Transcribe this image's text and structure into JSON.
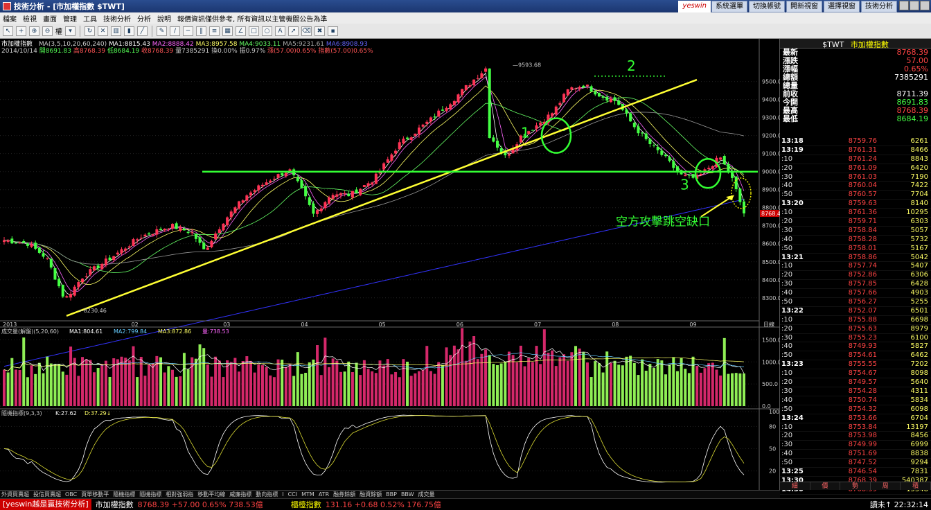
{
  "window": {
    "title": "技術分析 - [市加權指數 $TWT]"
  },
  "topbar": {
    "logo": "yeswin",
    "buttons": [
      "系統選單",
      "切換帳號",
      "開新視窗",
      "選擇視窗",
      "技術分析"
    ]
  },
  "menu": {
    "items": [
      "檔案",
      "檢視",
      "畫面",
      "管理",
      "工具",
      "技術分析",
      "分析",
      "說明",
      "報價資訊僅供參考, 所有資訊以主管機關公告為準"
    ]
  },
  "toolbar": {
    "zoom_label": "權"
  },
  "chart": {
    "symbol": "市加權指數",
    "ma_params": "MA(3,5,10,20,60,240)",
    "ma": [
      "MA1:8815.43",
      "MA2:8888.42",
      "MA3:8957.58",
      "MA4:9033.11",
      "MA5:9231.61",
      "MA6:8908.93"
    ],
    "bar_date": "2014/10/14",
    "ohlc": [
      "開8691.83",
      "高8768.39",
      "低8684.19",
      "收8768.39"
    ],
    "volume": "量7385291",
    "turnover": "換0.00%",
    "amplitude": "振0.97%",
    "change": "漲(57.00)0.65%",
    "index_change": "指數(57.00)0.65%",
    "y_ticks": [
      "9500.00",
      "9400.00",
      "9300.00",
      "9200.00",
      "9100.00",
      "9000.00",
      "8900.00",
      "8800.00",
      "8700.00",
      "8600.00",
      "8500.00",
      "8400.00",
      "8300.00"
    ],
    "x_labels": [
      "2013",
      "02",
      "03",
      "04",
      "05",
      "06",
      "07",
      "08",
      "09",
      "10"
    ],
    "period_label": "日線",
    "high_label": "9593.68",
    "low_label": "8230.46",
    "last_tag": "8768.4",
    "annotations": {
      "n1": "1",
      "n2": "2",
      "n3": "3",
      "gap_text": "空方攻擊跳空缺口"
    }
  },
  "volume_panel": {
    "title": "成交量(解盤)(5,20,60)",
    "ma": [
      "MA1:804.61",
      "MA2:799.84",
      "MA3:872.86",
      "量:738.53"
    ],
    "y_ticks": [
      "1500.0",
      "1000.0",
      "500.0",
      "0.0"
    ]
  },
  "kd_panel": {
    "title": "隨機指標(9,3,3)",
    "k": "K:27.62",
    "d": "D:37.29",
    "y_ticks": [
      "100",
      "80",
      "50",
      "20"
    ]
  },
  "indicator_tabs": [
    "外資買賣超",
    "投信買賣超",
    "OBC",
    "買單移動平",
    "隨機指標",
    "隨機指標",
    "相對強弱指",
    "移動平均線",
    "威廉指標",
    "動向指標",
    "I",
    "CCI",
    "MTM",
    "ATR",
    "融券餘額",
    "融資餘額",
    "BBP",
    "BBW",
    "成交量"
  ],
  "quote_panel": {
    "header": "$TWT",
    "name": "市加權指數",
    "rows": [
      {
        "label": "最新",
        "value": "8768.39",
        "color": "#ff4444"
      },
      {
        "label": "漲跌",
        "value": "57.00",
        "color": "#ff4444"
      },
      {
        "label": "漲幅",
        "value": "0.65%",
        "color": "#ff4444"
      },
      {
        "label": "總額",
        "value": "7385291",
        "color": "#ffffff"
      },
      {
        "label": "總量",
        "value": "",
        "color": "#ffffff"
      },
      {
        "label": "前收",
        "value": "8711.39",
        "color": "#ffffff"
      },
      {
        "label": "今開",
        "value": "8691.83",
        "color": "#44ff44"
      },
      {
        "label": "最高",
        "value": "8768.39",
        "color": "#ff4444"
      },
      {
        "label": "最低",
        "value": "8684.19",
        "color": "#44ff44"
      }
    ],
    "ticks": [
      {
        "time": "13:18",
        "price": "8759.76",
        "vol": "6261"
      },
      {
        "time": "13:19",
        "price": "8761.31",
        "vol": "8466"
      },
      {
        "time": ":10",
        "price": "8761.24",
        "vol": "8843"
      },
      {
        "time": ":20",
        "price": "8761.09",
        "vol": "6420"
      },
      {
        "time": ":30",
        "price": "8761.03",
        "vol": "7190"
      },
      {
        "time": ":40",
        "price": "8760.04",
        "vol": "7422"
      },
      {
        "time": ":50",
        "price": "8760.57",
        "vol": "7704"
      },
      {
        "time": "13:20",
        "price": "8759.63",
        "vol": "8140"
      },
      {
        "time": ":10",
        "price": "8761.36",
        "vol": "10295"
      },
      {
        "time": ":20",
        "price": "8759.71",
        "vol": "6303"
      },
      {
        "time": ":30",
        "price": "8758.84",
        "vol": "5057"
      },
      {
        "time": ":40",
        "price": "8758.28",
        "vol": "5732"
      },
      {
        "time": ":50",
        "price": "8758.01",
        "vol": "5167"
      },
      {
        "time": "13:21",
        "price": "8758.86",
        "vol": "5042"
      },
      {
        "time": ":10",
        "price": "8757.74",
        "vol": "5407"
      },
      {
        "time": ":20",
        "price": "8752.86",
        "vol": "6306"
      },
      {
        "time": ":30",
        "price": "8757.85",
        "vol": "6428"
      },
      {
        "time": ":40",
        "price": "8757.66",
        "vol": "4903"
      },
      {
        "time": ":50",
        "price": "8756.27",
        "vol": "5255"
      },
      {
        "time": "13:22",
        "price": "8752.07",
        "vol": "6501"
      },
      {
        "time": ":10",
        "price": "8755.88",
        "vol": "6698"
      },
      {
        "time": ":20",
        "price": "8755.63",
        "vol": "8979"
      },
      {
        "time": ":30",
        "price": "8755.23",
        "vol": "6100"
      },
      {
        "time": ":40",
        "price": "8749.93",
        "vol": "5827"
      },
      {
        "time": ":50",
        "price": "8754.61",
        "vol": "6462"
      },
      {
        "time": "13:23",
        "price": "8755.55",
        "vol": "7202"
      },
      {
        "time": ":10",
        "price": "8754.67",
        "vol": "8098"
      },
      {
        "time": ":20",
        "price": "8749.57",
        "vol": "5640"
      },
      {
        "time": ":30",
        "price": "8754.28",
        "vol": "4311"
      },
      {
        "time": ":40",
        "price": "8750.74",
        "vol": "5834"
      },
      {
        "time": ":50",
        "price": "8754.32",
        "vol": "6098"
      },
      {
        "time": "13:24",
        "price": "8753.66",
        "vol": "6704"
      },
      {
        "time": ":10",
        "price": "8753.84",
        "vol": "13197"
      },
      {
        "time": ":20",
        "price": "8753.98",
        "vol": "8456"
      },
      {
        "time": ":30",
        "price": "8749.99",
        "vol": "6999"
      },
      {
        "time": ":40",
        "price": "8751.69",
        "vol": "8838"
      },
      {
        "time": ":50",
        "price": "8747.52",
        "vol": "9294"
      },
      {
        "time": "13:25",
        "price": "8746.54",
        "vol": "7831"
      },
      {
        "time": "13:30",
        "price": "8768.39",
        "vol": "540387"
      },
      {
        "time": "14:30",
        "price": "8768.39",
        "vol": "15548"
      }
    ],
    "tabs": [
      "細",
      "價",
      "勢",
      "周",
      "積"
    ]
  },
  "statusbar": {
    "brand": "[yeswin越是贏技術分析]",
    "idx_name": "市加權指數",
    "idx_val": "8768.39 +57.00 0.65% 738.53億",
    "otc_name": "櫃檯指數",
    "otc_val": "131.16 +0.68 0.52% 176.75億",
    "right": "讀未↑ 22:32:14"
  },
  "colors": {
    "up": "#ff3355",
    "down": "#44ff44",
    "trendline": "#ffff33",
    "support": "#33ff33"
  }
}
